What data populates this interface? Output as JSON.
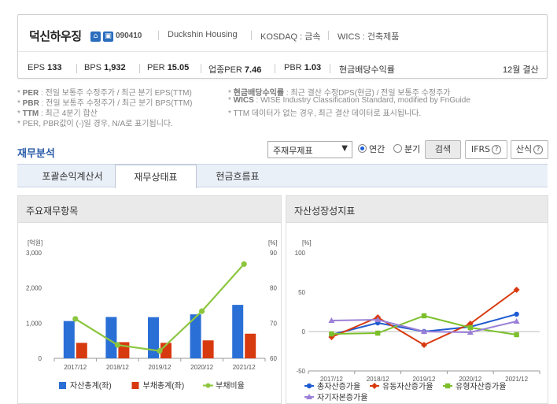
{
  "company": {
    "name": "덕신하우징",
    "code": "090410",
    "eng_name": "Duckshin Housing",
    "market": "KOSDAQ : 금속",
    "wics": "WICS : 건축제품",
    "stats": [
      {
        "label": "EPS",
        "value": "133"
      },
      {
        "label": "BPS",
        "value": "1,932"
      },
      {
        "label": "PER",
        "value": "15.05"
      },
      {
        "label": "업종PER",
        "value": "7.46"
      },
      {
        "label": "PBR",
        "value": "1.03"
      },
      {
        "label": "현금배당수익률",
        "value": ""
      }
    ],
    "settlement": "12월 결산"
  },
  "notes": {
    "left": [
      {
        "key": "PER",
        "text": " : 전일 보통주 수정주가 / 최근 분기 EPS(TTM)"
      },
      {
        "key": "PBR",
        "text": " : 전일 보통주 수정주가 / 최근 분기 BPS(TTM)"
      },
      {
        "key": "TTM",
        "text": " : 최근 4분기 합산"
      },
      {
        "key": "",
        "text": "PER, PBR값이 (-)일 경우, N/A로 표기됩니다."
      }
    ],
    "right": [
      {
        "key": "현금배당수익률",
        "text": " : 최근 결산 수정DPS(현금) / 전일 보통주 수정주가"
      },
      {
        "key": "WICS",
        "text": " : WISE Industry Classification Standard, modified by FnGuide"
      },
      {
        "key": "",
        "text": "TTM 데이터가 없는 경우, 최근 결산 데이터로 표시됩니다."
      }
    ]
  },
  "section": {
    "title": "재무분석",
    "select_value": "주재무제표",
    "radio_annual": "연간",
    "radio_quarter": "분기",
    "search_btn": "검색",
    "ifrs_btn": "IFRS",
    "formula_btn": "산식",
    "help_glyph": "?"
  },
  "tabs": [
    {
      "label": "포괄손익계산서",
      "active": false
    },
    {
      "label": "재무상태표",
      "active": true
    },
    {
      "label": "현금흐름표",
      "active": false
    }
  ],
  "chart_data": [
    {
      "type": "bar",
      "title": "주요재무항목",
      "categories": [
        "2017/12",
        "2018/12",
        "2019/12",
        "2020/12",
        "2021/12"
      ],
      "left_unit": "[억원]",
      "right_unit": "[%]",
      "ylim_left": [
        0,
        3000
      ],
      "yticks_left": [
        "0",
        "1,000",
        "2,000",
        "3,000"
      ],
      "ylim_right": [
        60,
        90
      ],
      "yticks_right": [
        "60",
        "70",
        "80",
        "90"
      ],
      "series": [
        {
          "name": "자산총계(좌)",
          "kind": "bar",
          "color": "#2a6fd6",
          "values": [
            1060,
            1175,
            1170,
            1250,
            1520
          ]
        },
        {
          "name": "부채총계(좌)",
          "kind": "bar",
          "color": "#d83a10",
          "values": [
            440,
            460,
            440,
            510,
            700
          ]
        },
        {
          "name": "부채비율",
          "kind": "line",
          "axis": "right",
          "color": "#8cc63e",
          "values": [
            71.2,
            63.8,
            62.1,
            73.4,
            86.8
          ]
        }
      ]
    },
    {
      "type": "line",
      "title": "자산성장성지표",
      "categories": [
        "2017/12",
        "2018/12",
        "2019/12",
        "2020/12",
        "2021/12"
      ],
      "unit": "[%]",
      "ylim": [
        -50,
        100
      ],
      "yticks": [
        "-50",
        "0",
        "50",
        "100"
      ],
      "series": [
        {
          "name": "총자산증가율",
          "color": "#1f5bd1",
          "marker": "circle",
          "values": [
            -4,
            11,
            0,
            6,
            22
          ]
        },
        {
          "name": "유동자산증가율",
          "color": "#d83a10",
          "marker": "diamond",
          "values": [
            -7,
            18,
            -17,
            10,
            53
          ]
        },
        {
          "name": "유형자산증가율",
          "color": "#7cbf2b",
          "marker": "square",
          "values": [
            -3,
            -2,
            20,
            5,
            -4
          ]
        },
        {
          "name": "자기자본증가율",
          "color": "#9a7fd6",
          "marker": "triangle",
          "values": [
            14,
            15,
            0,
            -1,
            13
          ]
        }
      ]
    }
  ]
}
